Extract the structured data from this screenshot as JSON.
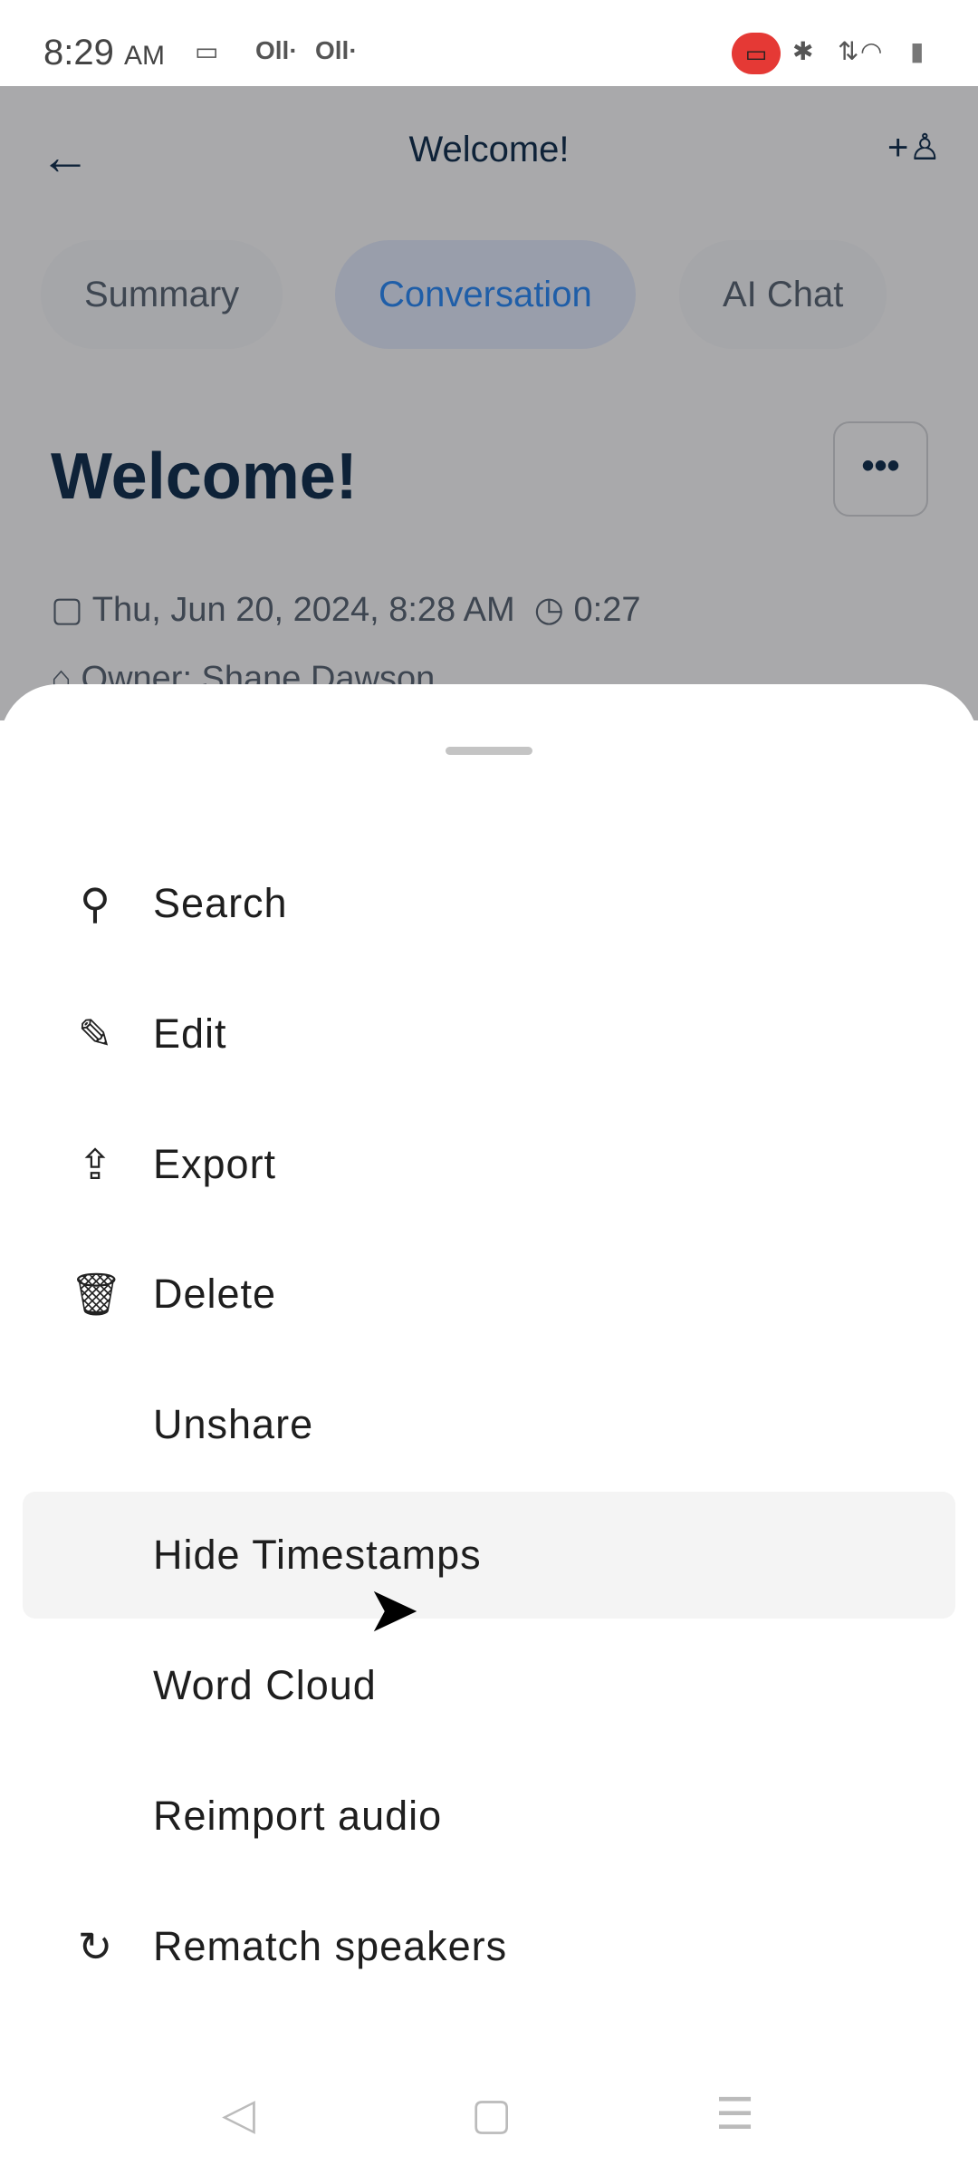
{
  "status_bar": {
    "time": "8:29",
    "ampm": "AM"
  },
  "header": {
    "title": "Welcome!"
  },
  "tabs": [
    {
      "label": "Summary"
    },
    {
      "label": "Conversation",
      "active": true
    },
    {
      "label": "AI Chat"
    }
  ],
  "page": {
    "title": "Welcome!",
    "date": "Thu, Jun 20, 2024, 8:28 AM",
    "duration": "0:27",
    "owner": "Owner: Shane Dawson"
  },
  "menu": {
    "items": [
      {
        "label": "Search",
        "icon": "search-icon"
      },
      {
        "label": "Edit",
        "icon": "pencil-icon"
      },
      {
        "label": "Export",
        "icon": "share-icon"
      },
      {
        "label": "Delete",
        "icon": "trash-icon"
      },
      {
        "label": "Unshare"
      },
      {
        "label": "Hide Timestamps",
        "highlighted": true
      },
      {
        "label": "Word Cloud"
      },
      {
        "label": "Reimport audio"
      },
      {
        "label": "Rematch speakers",
        "icon": "refresh-icon"
      }
    ]
  },
  "colors": {
    "accent": "#1f5ea8",
    "record": "#e53935",
    "scrim": "#a9a9ab"
  }
}
